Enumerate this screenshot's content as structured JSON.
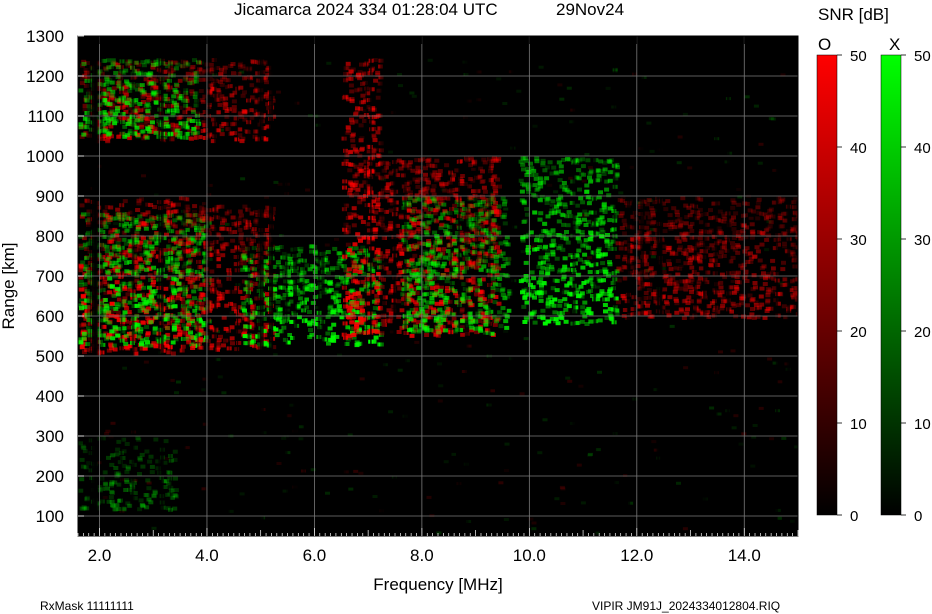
{
  "header": {
    "title": "Jicamarca 2024 334 01:28:04 UTC",
    "date": "29Nov24"
  },
  "footer": {
    "rxmask": "RxMask 11111111",
    "file": "VIPIR  JM91J_2024334012804.RIQ"
  },
  "colorbars": {
    "title": "SNR [dB]",
    "o_label": "O",
    "x_label": "X",
    "ticks": [
      0,
      10,
      20,
      30,
      40,
      50
    ],
    "o_colors": [
      "#000000",
      "#ff0000"
    ],
    "x_colors": [
      "#000000",
      "#00ff00"
    ]
  },
  "chart_data": {
    "type": "heatmap",
    "title": "Jicamarca 2024 334 01:28:04 UTC",
    "xlabel": "Frequency [MHz]",
    "ylabel": "Range [km]",
    "xlim": [
      1.6,
      15.0
    ],
    "ylim": [
      50,
      1300
    ],
    "data_range_max": 1245,
    "xticks": [
      "2.0",
      "4.0",
      "6.0",
      "8.0",
      "10.0",
      "12.0",
      "14.0"
    ],
    "xtick_values": [
      2.0,
      4.0,
      6.0,
      8.0,
      10.0,
      12.0,
      14.0
    ],
    "yticks": [
      100,
      200,
      300,
      400,
      500,
      600,
      700,
      800,
      900,
      1000,
      1100,
      1200,
      1300
    ],
    "grid": true,
    "echo_regions": [
      {
        "mode": "O",
        "f_start": 1.6,
        "f_end": 3.6,
        "r_start": 510,
        "r_end": 900,
        "snr_db": 40
      },
      {
        "mode": "X",
        "f_start": 1.6,
        "f_end": 4.0,
        "r_start": 530,
        "r_end": 860,
        "snr_db": 38
      },
      {
        "mode": "O",
        "f_start": 3.6,
        "f_end": 5.2,
        "r_start": 520,
        "r_end": 880,
        "snr_db": 34
      },
      {
        "mode": "X",
        "f_start": 4.6,
        "f_end": 7.2,
        "r_start": 530,
        "r_end": 780,
        "snr_db": 42
      },
      {
        "mode": "O",
        "f_start": 6.5,
        "f_end": 7.2,
        "r_start": 550,
        "r_end": 1245,
        "snr_db": 40
      },
      {
        "mode": "O",
        "f_start": 7.2,
        "f_end": 9.4,
        "r_start": 555,
        "r_end": 1000,
        "snr_db": 36
      },
      {
        "mode": "X",
        "f_start": 7.6,
        "f_end": 9.6,
        "r_start": 560,
        "r_end": 900,
        "snr_db": 32
      },
      {
        "mode": "X",
        "f_start": 9.8,
        "f_end": 11.6,
        "r_start": 585,
        "r_end": 1000,
        "snr_db": 40
      },
      {
        "mode": "O",
        "f_start": 11.6,
        "f_end": 15.0,
        "r_start": 600,
        "r_end": 900,
        "snr_db": 24
      },
      {
        "mode": "O",
        "f_start": 1.6,
        "f_end": 5.2,
        "r_start": 1040,
        "r_end": 1245,
        "snr_db": 30
      },
      {
        "mode": "X",
        "f_start": 1.6,
        "f_end": 3.8,
        "r_start": 1050,
        "r_end": 1245,
        "snr_db": 34
      },
      {
        "mode": "X",
        "f_start": 1.6,
        "f_end": 3.4,
        "r_start": 120,
        "r_end": 300,
        "snr_db": 14
      }
    ]
  }
}
